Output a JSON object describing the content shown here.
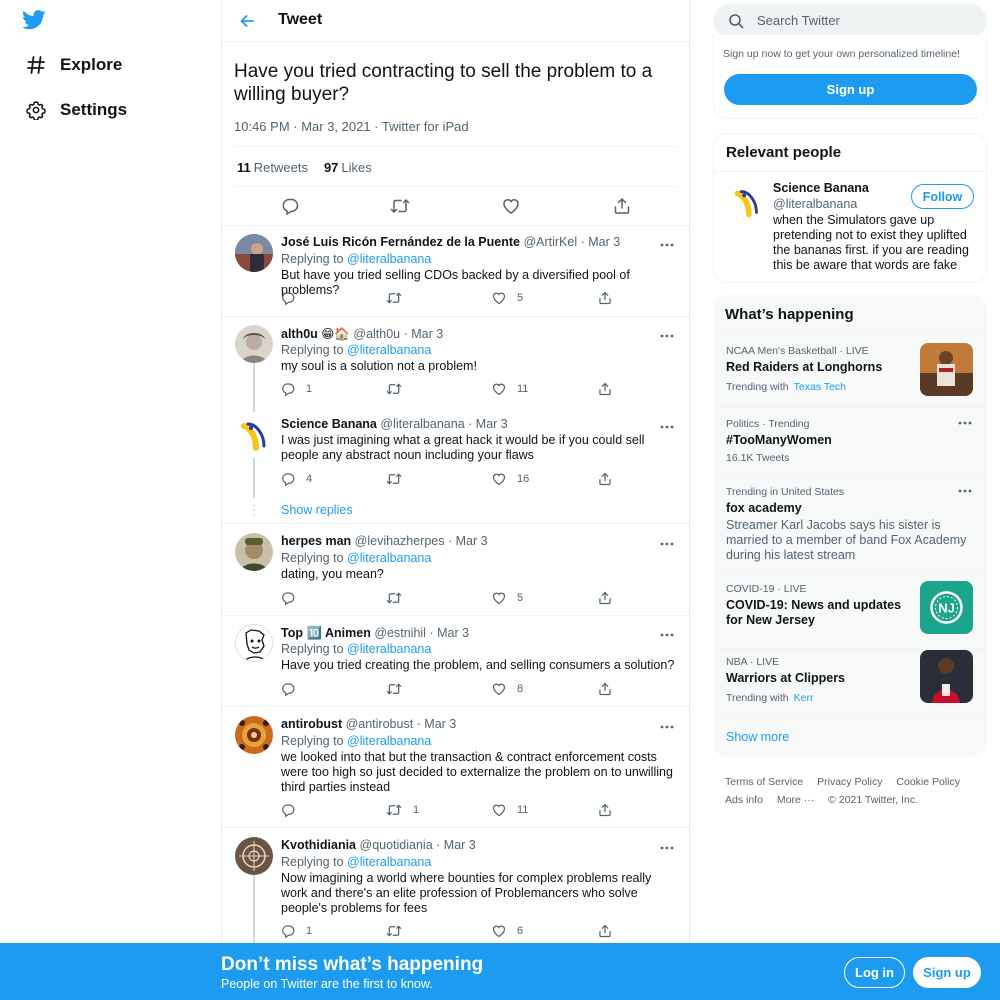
{
  "nav": {
    "explore_label": "Explore",
    "settings_label": "Settings"
  },
  "header": {
    "title": "Tweet"
  },
  "tweet": {
    "text": "Have you tried contracting to sell the problem to a willing buyer?",
    "time": "10:46 PM · Mar 3, 2021 · Twitter for iPad",
    "retweets_count": "11",
    "retweets_label": "Retweets",
    "likes_count": "97",
    "likes_label": "Likes"
  },
  "replies": [
    {
      "name": "José Luis Ricón Fernández de la Puente",
      "handle": "@ArtirKel",
      "date": "· Mar 3",
      "replying_prefix": "Replying to",
      "mention": "@literalbanana",
      "text": "But have you tried selling CDOs backed by a diversified pool of problems?",
      "replies": "",
      "retweets": "",
      "likes": "5"
    },
    {
      "name": "alth0u 😁🏠",
      "handle": "@alth0u",
      "date": "· Mar 3",
      "replying_prefix": "Replying to",
      "mention": "@literalbanana",
      "text": "my soul is a solution not a problem!",
      "replies": "1",
      "retweets": "",
      "likes": "11"
    },
    {
      "name": "Science Banana",
      "handle": "@literalbanana",
      "date": "· Mar 3",
      "text": "I was just imagining what a great hack it would be if you could sell people any abstract noun including your flaws",
      "replies": "4",
      "retweets": "",
      "likes": "16"
    },
    {
      "name": "herpes man",
      "handle": "@levihazherpes",
      "date": "· Mar 3",
      "replying_prefix": "Replying to",
      "mention": "@literalbanana",
      "text": "dating, you mean?",
      "replies": "",
      "retweets": "",
      "likes": "5"
    },
    {
      "name": "Top 🔟 Animen",
      "handle": "@estnihil",
      "date": "· Mar 3",
      "replying_prefix": "Replying to",
      "mention": "@literalbanana",
      "text": "Have you tried creating the problem, and selling consumers a solution?",
      "replies": "",
      "retweets": "",
      "likes": "8"
    },
    {
      "name": "antirobust",
      "handle": "@antirobust",
      "date": "· Mar 3",
      "replying_prefix": "Replying to",
      "mention": "@literalbanana",
      "text": "we looked into that but the transaction & contract enforcement costs were too high so just decided to externalize the problem on to unwilling third parties instead",
      "replies": "",
      "retweets": "1",
      "likes": "11"
    },
    {
      "name": "Kvothidiania",
      "handle": "@quotidiania",
      "date": "· Mar 3",
      "replying_prefix": "Replying to",
      "mention": "@literalbanana",
      "text": "Now imagining a world where bounties for complex problems really work and there's an elite profession of Problemancers who solve people's problems for fees",
      "replies": "1",
      "retweets": "",
      "likes": "6"
    }
  ],
  "show_replies": "Show replies",
  "search": {
    "placeholder": "Search Twitter"
  },
  "signup_card": {
    "text": "Sign up now to get your own personalized timeline!",
    "button": "Sign up"
  },
  "relevant": {
    "title": "Relevant people",
    "name": "Science Banana",
    "handle": "@literalbanana",
    "bio": "when the Simulators gave up pretending not to exist they uplifted the bananas first. if you are reading this be aware that words are fake",
    "follow": "Follow"
  },
  "happening": {
    "title": "What’s happening",
    "trends": [
      {
        "category": "NCAA Men's Basketball · LIVE",
        "title": "Red Raiders at Longhorns",
        "sub_prefix": "Trending with",
        "sub_link": "Texas Tech"
      },
      {
        "category": "Politics · Trending",
        "title": "#TooManyWomen",
        "sub": "16.1K Tweets"
      },
      {
        "category": "Trending in United States",
        "title": "fox academy",
        "desc": "Streamer Karl Jacobs says his sister is married to a member of band Fox Academy during his latest stream"
      },
      {
        "category": "COVID-19 · LIVE",
        "title": "COVID-19: News and updates for New Jersey"
      },
      {
        "category": "NBA · LIVE",
        "title": "Warriors at Clippers",
        "sub_prefix": "Trending with",
        "sub_link": "Kerr"
      }
    ],
    "show_more": "Show more"
  },
  "footer": {
    "terms": "Terms of Service",
    "privacy": "Privacy Policy",
    "cookie": "Cookie Policy",
    "ads": "Ads info",
    "more": "More ···",
    "copyright": "© 2021 Twitter, Inc."
  },
  "banner": {
    "title": "Don’t miss what’s happening",
    "subtitle": "People on Twitter are the first to know.",
    "login": "Log in",
    "signup": "Sign up"
  },
  "colors": {
    "brand": "#1d9bf0",
    "text": "#0f1419",
    "secondary": "#536471"
  },
  "icons": [
    "twitter-bird-icon",
    "hashtag-icon",
    "gear-icon",
    "back-arrow-icon",
    "reply-icon",
    "retweet-icon",
    "like-icon",
    "share-icon",
    "more-dots-icon",
    "search-icon"
  ]
}
